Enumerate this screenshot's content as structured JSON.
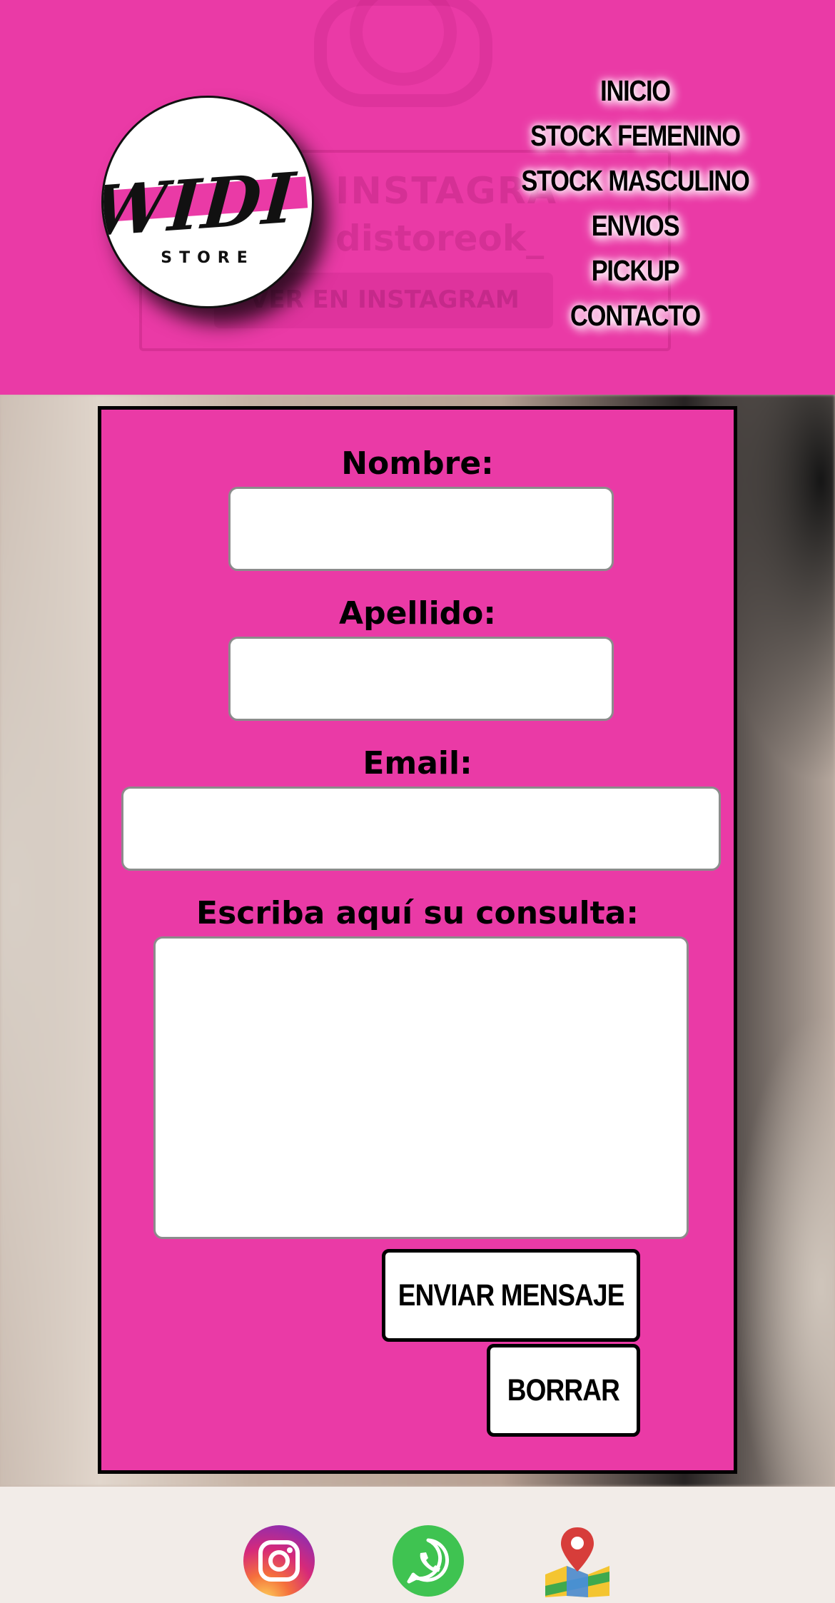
{
  "header": {
    "ghost_banner": {
      "title": "INSTAGRA",
      "username": "distoreok_",
      "button_label": "VER EN INSTAGRAM"
    },
    "logo": {
      "brand": "WIDI",
      "sub": "STORE",
      "stripe_color": "#ea3aa6"
    },
    "nav": [
      "INICIO",
      "STOCK FEMENINO",
      "STOCK MASCULINO",
      "ENVIOS",
      "PICKUP",
      "CONTACTO"
    ],
    "background_color": "#ea3aa6"
  },
  "form": {
    "nombre_label": "Nombre:",
    "nombre_value": "",
    "apellido_label": "Apellido:",
    "apellido_value": "",
    "email_label": "Email:",
    "email_value": "",
    "consulta_label": "Escriba aquí su consulta:",
    "consulta_value": "",
    "send_label": "ENVIAR MENSAJE",
    "reset_label": "BORRAR",
    "card_color": "#ea3aa6"
  },
  "footer": {
    "icons": [
      "instagram-icon",
      "whatsapp-icon",
      "maps-icon"
    ]
  }
}
